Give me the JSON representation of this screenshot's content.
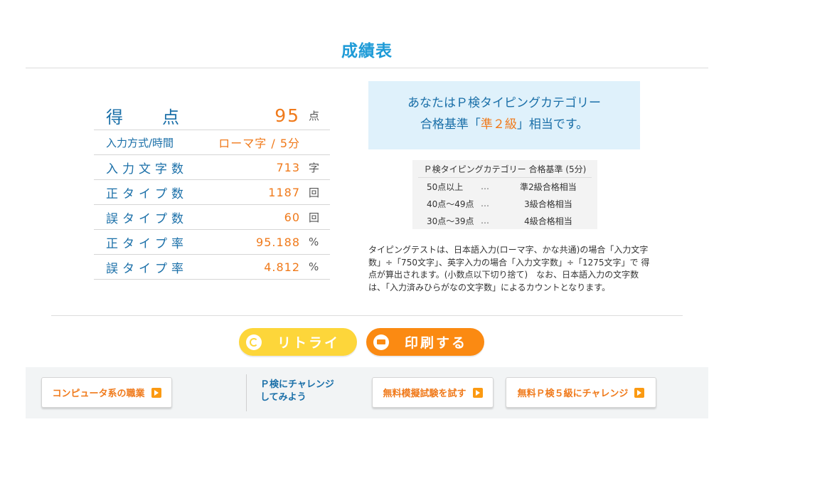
{
  "header": {
    "title": "成績表"
  },
  "score": {
    "main": {
      "label_chars": [
        "得",
        "点"
      ],
      "value": "95",
      "unit": "点"
    },
    "rows": [
      {
        "label": "入力方式/時間",
        "value": "ローマ字 / 5分",
        "unit": ""
      },
      {
        "label": "入力文字数",
        "value": "713",
        "unit": "字"
      },
      {
        "label": "正タイプ数",
        "value": "1187",
        "unit": "回"
      },
      {
        "label": "誤タイプ数",
        "value": "60",
        "unit": "回"
      },
      {
        "label": "正タイプ率",
        "value": "95.188",
        "unit": "%"
      },
      {
        "label": "誤タイプ率",
        "value": "4.812",
        "unit": "%"
      }
    ]
  },
  "result": {
    "line1": "あなたはＰ検タイピングカテゴリー",
    "line2_prefix": "合格基準「",
    "grade": "準２級",
    "line2_suffix": "」相当です。"
  },
  "criteria": {
    "title": "Ｐ検タイピングカテゴリー 合格基準 (5分)",
    "rows": [
      {
        "range": "50点以上",
        "sep": "…",
        "level": "準2級合格相当"
      },
      {
        "range": "40点～49点",
        "sep": "…",
        "level": "3級合格相当"
      },
      {
        "range": "30点～39点",
        "sep": "…",
        "level": "4級合格相当"
      }
    ]
  },
  "note": "タイピングテストは、日本語入力(ローマ字、かな共通)の場合「入力文字数」÷「750文字」、英字入力の場合「入力文字数」÷「1275文字」で 得点が算出されます。(小数点以下切り捨て)　なお、日本語入力の文字数は、「入力済みひらがなの文字数」によるカウントとなります。",
  "actions": {
    "retry": "リトライ",
    "print": "印刷する"
  },
  "footer": {
    "computer_jobs": "コンピュータ系の職業",
    "challenge": "Ｐ検にチャレンジ\nしてみよう",
    "mock_exam": "無料模擬試験を試す",
    "grade5": "無料Ｐ検５級にチャレンジ"
  },
  "colors": {
    "accent_blue": "#1e9bd7",
    "label_blue": "#1a6fa8",
    "orange": "#f07a1b",
    "yellow": "#fdd63a",
    "result_bg": "#dff1fb"
  }
}
